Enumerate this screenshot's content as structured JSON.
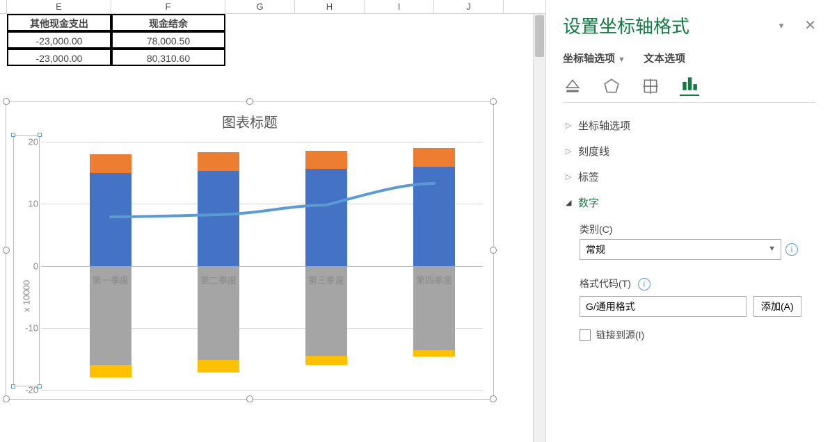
{
  "columns": [
    "E",
    "F",
    "G",
    "H",
    "I",
    "J"
  ],
  "table": {
    "headers": [
      "其他现金支出",
      "现金结余"
    ],
    "rows": [
      [
        "-23,000.00",
        "78,000.50"
      ],
      [
        "-23,000.00",
        "80,310.60"
      ]
    ]
  },
  "chart": {
    "title": "图表标题",
    "ylabel": "x 10000",
    "yticks": [
      "20",
      "10",
      "0",
      "-10",
      "-20"
    ],
    "categories": [
      "第一季度",
      "第二季度",
      "第三季度",
      "第四季度"
    ]
  },
  "chart_data": {
    "type": "bar",
    "categories": [
      "第一季度",
      "第二季度",
      "第三季度",
      "第四季度"
    ],
    "series": [
      {
        "name": "蓝色",
        "values": [
          15.0,
          15.3,
          15.6,
          16.0
        ]
      },
      {
        "name": "橙色",
        "values": [
          3.0,
          3.0,
          3.0,
          3.0
        ]
      },
      {
        "name": "灰色",
        "values": [
          -16.0,
          -15.2,
          -14.5,
          -13.6
        ]
      },
      {
        "name": "金色",
        "values": [
          -2.0,
          -2.0,
          -1.4,
          -1.0
        ]
      },
      {
        "name": "折线",
        "values": [
          7.8,
          8.2,
          9.8,
          13.2
        ]
      }
    ],
    "title": "图表标题",
    "xlabel": "",
    "ylabel": "x 10000",
    "ylim": [
      -20,
      20
    ]
  },
  "panel": {
    "title": "设置坐标轴格式",
    "tab_axis": "坐标轴选项",
    "tab_text": "文本选项",
    "sections": {
      "axis_options": "坐标轴选项",
      "ticks": "刻度线",
      "labels": "标签",
      "number": "数字"
    },
    "number": {
      "category_label": "类别(C)",
      "category_value": "常规",
      "format_label": "格式代码(T)",
      "format_value": "G/通用格式",
      "add_label": "添加(A)",
      "link_label": "链接到源(I)"
    }
  }
}
